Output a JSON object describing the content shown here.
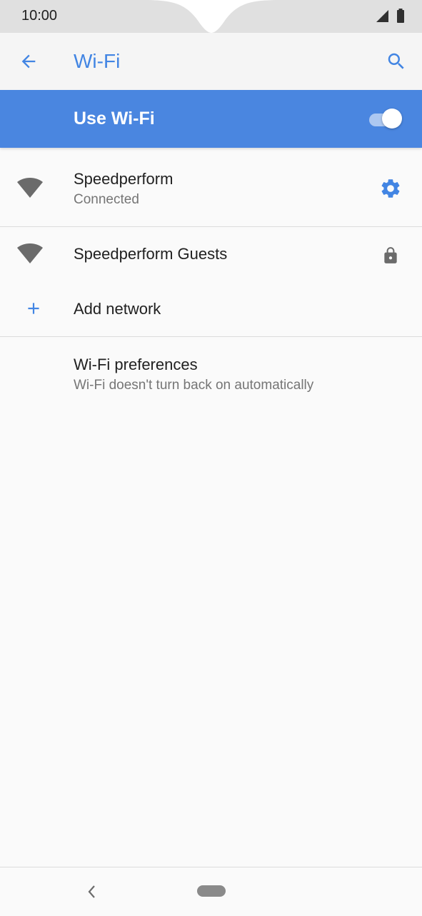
{
  "status_bar": {
    "time": "10:00"
  },
  "app_bar": {
    "title": "Wi-Fi"
  },
  "master_switch": {
    "label": "Use Wi-Fi",
    "enabled": true
  },
  "networks": [
    {
      "name": "Speedperform",
      "status": "Connected"
    },
    {
      "name": "Speedperform Guests",
      "status": ""
    }
  ],
  "add_network": {
    "label": "Add network"
  },
  "preferences": {
    "title": "Wi-Fi preferences",
    "summary": "Wi-Fi doesn't turn back on automatically"
  },
  "colors": {
    "accent": "#4285e3",
    "master_bar": "#4a86e0",
    "icon_gray": "#6b6b6b"
  }
}
